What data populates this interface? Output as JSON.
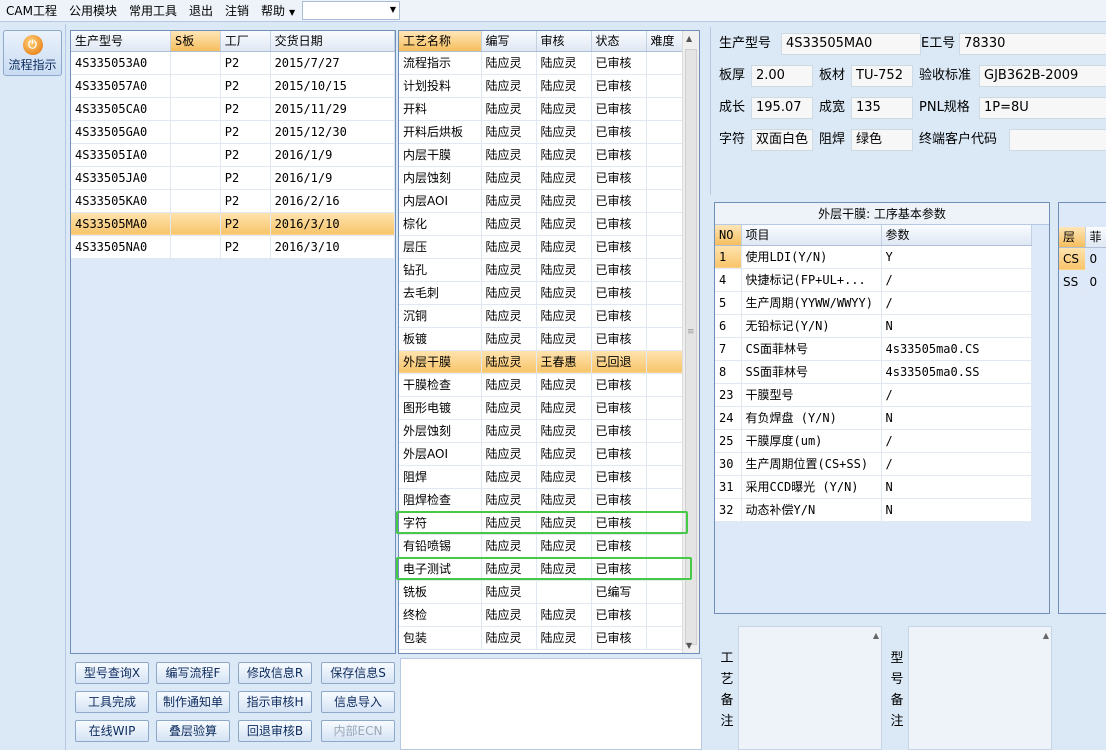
{
  "menu": {
    "items": [
      "CAM工程",
      "公用模块",
      "常用工具",
      "退出",
      "注销",
      "帮助"
    ],
    "combo_value": ""
  },
  "nav": {
    "flow_label": "流程指示",
    "flow_icon": "power-orb-icon"
  },
  "model_grid": {
    "headers": [
      "生产型号",
      "S板",
      "工厂",
      "交货日期"
    ],
    "selected_index": 7,
    "rows": [
      [
        "4S335053A0",
        "",
        "P2",
        "2015/7/27"
      ],
      [
        "4S335057A0",
        "",
        "P2",
        "2015/10/15"
      ],
      [
        "4S33505CA0",
        "",
        "P2",
        "2015/11/29"
      ],
      [
        "4S33505GA0",
        "",
        "P2",
        "2015/12/30"
      ],
      [
        "4S33505IA0",
        "",
        "P2",
        "2016/1/9"
      ],
      [
        "4S33505JA0",
        "",
        "P2",
        "2016/1/9"
      ],
      [
        "4S33505KA0",
        "",
        "P2",
        "2016/2/16"
      ],
      [
        "4S33505MA0",
        "",
        "P2",
        "2016/3/10"
      ],
      [
        "4S33505NA0",
        "",
        "P2",
        "2016/3/10"
      ]
    ]
  },
  "process_grid": {
    "headers": [
      "工艺名称",
      "编写",
      "审核",
      "状态",
      "难度"
    ],
    "selected_index": 14,
    "highlighted_indices": [
      21,
      23
    ],
    "rows": [
      [
        "流程指示",
        "陆应灵",
        "陆应灵",
        "已审核",
        ""
      ],
      [
        "计划投料",
        "陆应灵",
        "陆应灵",
        "已审核",
        ""
      ],
      [
        "开料",
        "陆应灵",
        "陆应灵",
        "已审核",
        ""
      ],
      [
        "开料后烘板",
        "陆应灵",
        "陆应灵",
        "已审核",
        ""
      ],
      [
        "内层干膜",
        "陆应灵",
        "陆应灵",
        "已审核",
        ""
      ],
      [
        "内层蚀刻",
        "陆应灵",
        "陆应灵",
        "已审核",
        ""
      ],
      [
        "内层AOI",
        "陆应灵",
        "陆应灵",
        "已审核",
        ""
      ],
      [
        "棕化",
        "陆应灵",
        "陆应灵",
        "已审核",
        ""
      ],
      [
        "层压",
        "陆应灵",
        "陆应灵",
        "已审核",
        ""
      ],
      [
        "钻孔",
        "陆应灵",
        "陆应灵",
        "已审核",
        ""
      ],
      [
        "去毛刺",
        "陆应灵",
        "陆应灵",
        "已审核",
        ""
      ],
      [
        "沉铜",
        "陆应灵",
        "陆应灵",
        "已审核",
        ""
      ],
      [
        "板镀",
        "陆应灵",
        "陆应灵",
        "已审核",
        ""
      ],
      [
        "外层干膜",
        "陆应灵",
        "王春惠",
        "已回退",
        ""
      ],
      [
        "干膜检查",
        "陆应灵",
        "陆应灵",
        "已审核",
        ""
      ],
      [
        "图形电镀",
        "陆应灵",
        "陆应灵",
        "已审核",
        ""
      ],
      [
        "外层蚀刻",
        "陆应灵",
        "陆应灵",
        "已审核",
        ""
      ],
      [
        "外层AOI",
        "陆应灵",
        "陆应灵",
        "已审核",
        ""
      ],
      [
        "阻焊",
        "陆应灵",
        "陆应灵",
        "已审核",
        ""
      ],
      [
        "阻焊检查",
        "陆应灵",
        "陆应灵",
        "已审核",
        ""
      ],
      [
        "字符",
        "陆应灵",
        "陆应灵",
        "已审核",
        ""
      ],
      [
        "有铅喷锡",
        "陆应灵",
        "陆应灵",
        "已审核",
        ""
      ],
      [
        "电子测试",
        "陆应灵",
        "陆应灵",
        "已审核",
        ""
      ],
      [
        "铣板",
        "陆应灵",
        "",
        "已编写",
        ""
      ],
      [
        "终检",
        "陆应灵",
        "陆应灵",
        "已审核",
        ""
      ],
      [
        "包装",
        "陆应灵",
        "陆应灵",
        "已审核",
        ""
      ]
    ]
  },
  "buttons": [
    [
      "型号查询X",
      "编写流程F",
      "修改信息R",
      "保存信息S"
    ],
    [
      "工具完成",
      "制作通知单",
      "指示审核H",
      "信息导入"
    ],
    [
      "在线WIP",
      "叠层验算",
      "回退审核B",
      "内部ECN"
    ]
  ],
  "info": {
    "model_label": "生产型号",
    "model_value": "4S33505MA0",
    "eno_label": "E工号",
    "eno_value": "78330",
    "thick_label": "板厚",
    "thick_value": "2.00",
    "material_label": "板材",
    "material_value": "TU-752",
    "std_label": "验收标准",
    "std_value": "GJB362B-2009",
    "len_label": "成长",
    "len_value": "195.07",
    "width_label": "成宽",
    "width_value": "135",
    "pnl_label": "PNL规格",
    "pnl_value": "1P=8U",
    "char_label": "字符",
    "char_value": "双面白色",
    "mask_label": "阻焊",
    "mask_value": "绿色",
    "cust_label": "终端客户代码",
    "cust_value": ""
  },
  "params": {
    "title": "外层干膜: 工序基本参数",
    "headers": [
      "NO",
      "项目",
      "参数"
    ],
    "rows": [
      [
        "1",
        "使用LDI(Y/N)",
        "Y"
      ],
      [
        "4",
        "快捷标记(FP+UL+...",
        "/"
      ],
      [
        "5",
        "生产周期(YYWW/WWYY)",
        "/"
      ],
      [
        "6",
        "无铅标记(Y/N)",
        "N"
      ],
      [
        "7",
        "CS面菲林号",
        "4s33505ma0.CS"
      ],
      [
        "8",
        "SS面菲林号",
        "4s33505ma0.SS"
      ],
      [
        "23",
        "干膜型号",
        "/"
      ],
      [
        "24",
        "有负焊盘 (Y/N)",
        "N"
      ],
      [
        "25",
        "干膜厚度(um)",
        "/"
      ],
      [
        "30",
        "生产周期位置(CS+SS)",
        "/"
      ],
      [
        "31",
        "采用CCD曝光 (Y/N)",
        "N"
      ],
      [
        "32",
        "动态补偿Y/N",
        "N"
      ]
    ]
  },
  "layers": {
    "headers": [
      "层",
      "菲"
    ],
    "rows": [
      [
        "CS",
        "0"
      ],
      [
        "SS",
        "0"
      ]
    ]
  },
  "remarks": {
    "process_label": "工艺备注",
    "model_label": "型号备注"
  },
  "colors": {
    "selection": "#f7c46a",
    "highlight_box": "#46c946",
    "panel_bg": "#dbe8f6"
  }
}
